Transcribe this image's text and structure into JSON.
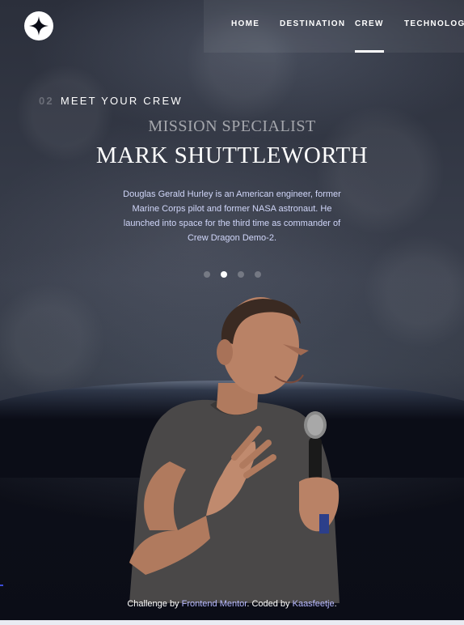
{
  "nav": {
    "items": [
      {
        "label": "HOME",
        "active": false
      },
      {
        "label": "DESTINATION",
        "active": false
      },
      {
        "label": "CREW",
        "active": true
      },
      {
        "label": "TECHNOLOGY",
        "active": false
      }
    ]
  },
  "page_heading": {
    "number": "02",
    "title": "MEET YOUR CREW"
  },
  "crew": {
    "role": "MISSION SPECIALIST",
    "name": "MARK SHUTTLEWORTH",
    "bio": "Douglas Gerald Hurley is an American engineer, former Marine Corps pilot and former NASA astronaut. He launched into space for the third time as commander of Crew Dragon Demo-2.",
    "slides": 4,
    "active_slide": 2
  },
  "footer": {
    "prefix": "Challenge by ",
    "link1": "Frontend Mentor",
    "middle": ". Coded by ",
    "link2": "Kaasfeetje",
    "suffix": "."
  },
  "colors": {
    "background": "#0b0d17",
    "accent_text": "#d0d6f9",
    "link": "#b7b9ff"
  },
  "icons": {
    "logo": "star-logo-icon"
  }
}
